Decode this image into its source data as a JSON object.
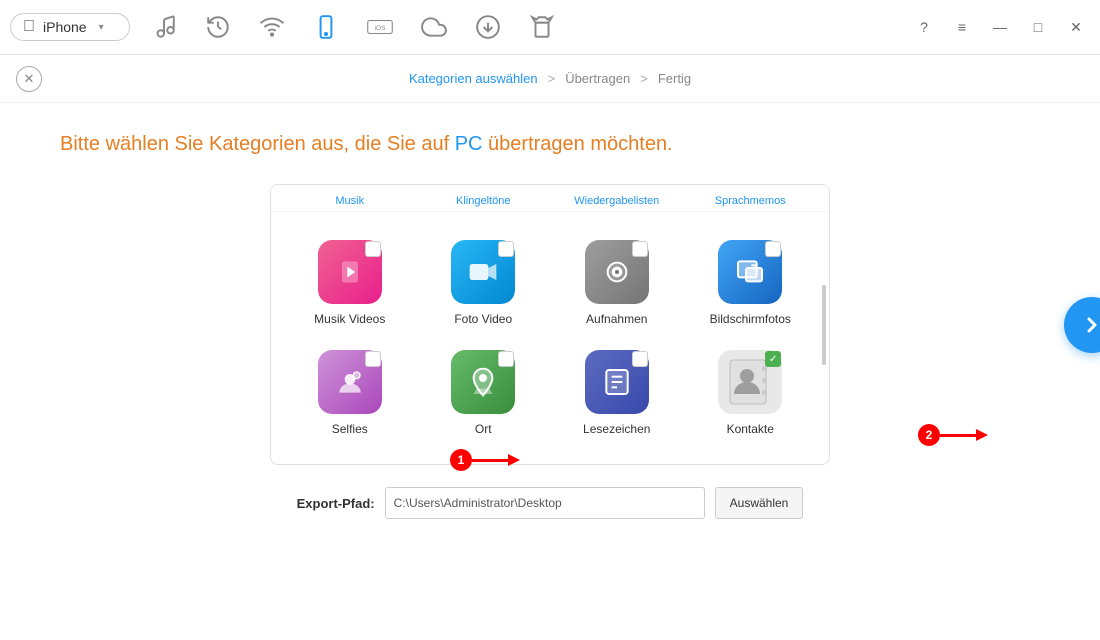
{
  "titlebar": {
    "device_name": "iPhone",
    "dropdown_arrow": "▾",
    "icons": [
      {
        "name": "music-icon",
        "label": "Musik"
      },
      {
        "name": "history-icon",
        "label": "Verlauf"
      },
      {
        "name": "wifi-icon",
        "label": "WLAN"
      },
      {
        "name": "phone-icon",
        "label": "Gerät"
      },
      {
        "name": "ios-icon",
        "label": "iOS"
      },
      {
        "name": "cloud-icon",
        "label": "Cloud"
      },
      {
        "name": "download-icon",
        "label": "Download"
      },
      {
        "name": "shirt-icon",
        "label": "Ringtone"
      }
    ],
    "right_icons": [
      {
        "name": "help-icon",
        "label": "?"
      },
      {
        "name": "menu-icon",
        "label": "≡"
      },
      {
        "name": "minimize-icon",
        "label": "—"
      },
      {
        "name": "maximize-icon",
        "label": "□"
      },
      {
        "name": "close-icon",
        "label": "✕"
      }
    ]
  },
  "breadcrumb": {
    "close_label": "✕",
    "steps": [
      {
        "label": "Kategorien auswählen",
        "active": true
      },
      {
        "label": "Übertragen",
        "active": false
      },
      {
        "label": "Fertig",
        "active": false
      }
    ],
    "separator": ">"
  },
  "main": {
    "heading": "Bitte wählen Sie Kategorien aus, die Sie auf PC übertragen möchten.",
    "partial_labels": [
      "Musik",
      "Klingeltöne",
      "Wiedergabelisten",
      "Sprachmemos"
    ],
    "categories": [
      {
        "id": "musik-videos",
        "label": "Musik Videos",
        "bg": "bg-musik-video",
        "checked": false,
        "icon": "🎬"
      },
      {
        "id": "foto-video",
        "label": "Foto Video",
        "bg": "bg-foto-video",
        "checked": false,
        "icon": "📹"
      },
      {
        "id": "aufnahmen",
        "label": "Aufnahmen",
        "bg": "bg-aufnahmen",
        "checked": false,
        "icon": "📷"
      },
      {
        "id": "bildschirmfotos",
        "label": "Bildschirmfotos",
        "bg": "bg-bildschirm",
        "checked": false,
        "icon": "🖼"
      },
      {
        "id": "selfies",
        "label": "Selfies",
        "bg": "bg-selfies",
        "checked": false,
        "icon": "📸"
      },
      {
        "id": "ort",
        "label": "Ort",
        "bg": "bg-ort",
        "checked": false,
        "icon": "📍"
      },
      {
        "id": "lesezeichen",
        "label": "Lesezeichen",
        "bg": "bg-lesezeichen",
        "checked": false,
        "icon": "📚"
      },
      {
        "id": "kontakte",
        "label": "Kontakte",
        "bg": "bg-kontakte",
        "checked": true,
        "icon": "👤"
      }
    ],
    "export_label": "Export-Pfad:",
    "export_path": "C:\\Users\\Administrator\\Desktop",
    "export_btn": "Auswählen",
    "next_btn": "›",
    "annotation1": "1",
    "annotation2": "2"
  }
}
